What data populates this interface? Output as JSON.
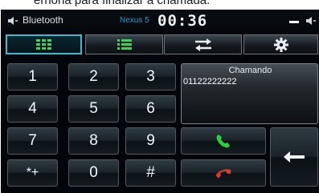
{
  "caption": "ernona para finalizar a chamada.",
  "status_bar": {
    "title": "Bluetooth",
    "device": "Nexus 5",
    "time": "00:36"
  },
  "tabs": [
    {
      "icon": "keypad-grid-icon",
      "active": true
    },
    {
      "icon": "contact-list-icon",
      "active": false
    },
    {
      "icon": "transfer-icon",
      "active": false
    },
    {
      "icon": "settings-gear-icon",
      "active": false
    }
  ],
  "keypad": {
    "keys": [
      "1",
      "2",
      "3",
      "4",
      "5",
      "6",
      "7",
      "8",
      "9",
      "*+",
      "0",
      "#"
    ]
  },
  "call": {
    "status": "Chamando",
    "number": "01122222222"
  },
  "colors": {
    "accent": "#3fb8d2",
    "answer": "#2ecc40",
    "hangup": "#e03a2e"
  }
}
